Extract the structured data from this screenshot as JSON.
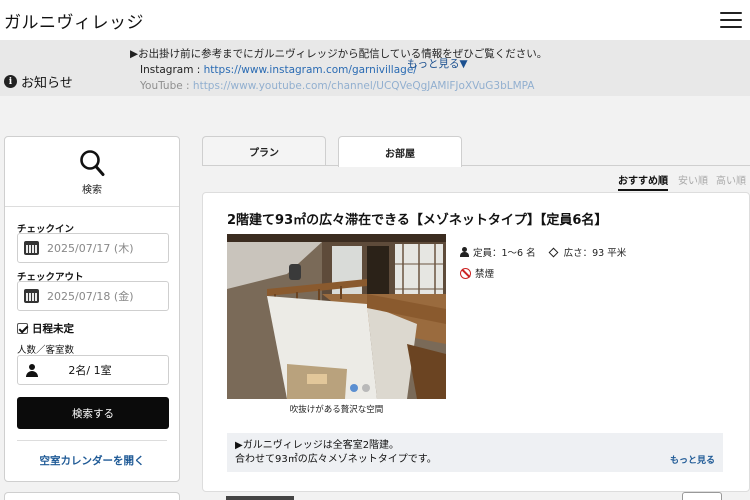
{
  "header": {
    "title": "ガルニヴィレッジ"
  },
  "notice": {
    "label": "お知らせ",
    "line1": "▶お出掛け前に参考までにガルニヴィレッジから配信している情報をぜひご覧ください。",
    "instagram_label": "Instagram : ",
    "instagram_url": "https://www.instagram.com/garnivillage/",
    "youtube_label": "YouTube : ",
    "youtube_url": "https://www.youtube.com/channel/UCQVeQgJAMlFJoXVuG3bLMPA",
    "more": "もっと見る▼"
  },
  "search": {
    "label": "検索",
    "checkin_label": "チェックイン",
    "checkin_value": "2025/07/17 (木)",
    "checkout_label": "チェックアウト",
    "checkout_value": "2025/07/18 (金)",
    "undecided_label": "日程未定",
    "undecided_checked": true,
    "guests_label": "人数／客室数",
    "guests_value": "2名/ 1室",
    "button": "検索する",
    "calendar_link": "空室カレンダーを開く"
  },
  "tabs": [
    {
      "label": "プラン",
      "active": false
    },
    {
      "label": "お部屋",
      "active": true
    }
  ],
  "sort": [
    {
      "label": "おすすめ順",
      "active": true
    },
    {
      "label": "安い順",
      "active": false
    },
    {
      "label": "高い順",
      "active": false
    }
  ],
  "room": {
    "title": "2階建て93㎡の広々滞在できる【メゾネットタイプ】【定員6名】",
    "capacity": "定員：1〜6 名",
    "area": "広さ：93 平米",
    "smoking": "禁煙",
    "photo_caption": "吹抜けがある贅沢な空間",
    "carousel_total": 2,
    "carousel_active": 1,
    "desc_line1": "▶ガルニヴィレッジは全客室2階建。",
    "desc_line2": "合わせて93㎡の広々メゾネットタイプです。",
    "desc_more": "もっと見る"
  },
  "colors": {
    "accent_link": "#1f5a96",
    "button_bg": "#0b0b0b",
    "notice_bg": "#e8e8e8"
  }
}
